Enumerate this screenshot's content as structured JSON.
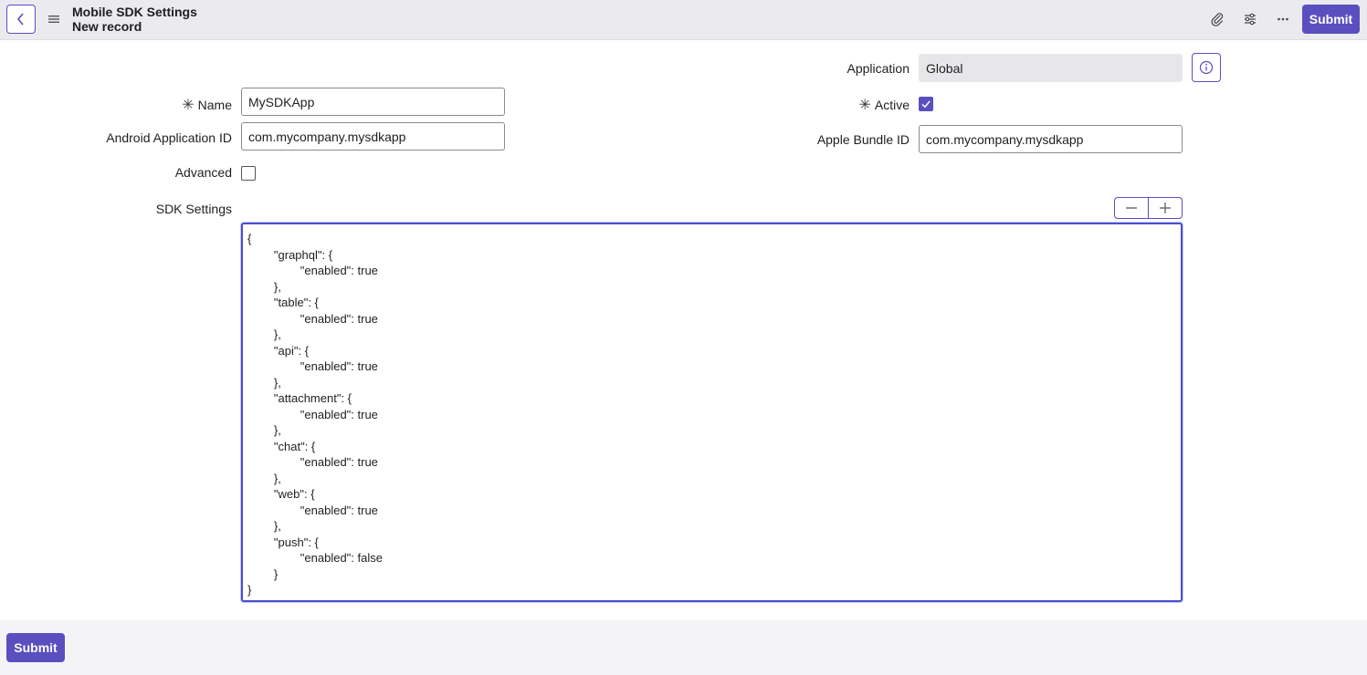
{
  "header": {
    "title": "Mobile SDK Settings",
    "subtitle": "New record",
    "submit_label": "Submit",
    "icons": [
      "back-icon",
      "menu-icon",
      "paperclip-icon",
      "sliders-icon",
      "more-icon"
    ]
  },
  "form": {
    "application": {
      "label": "Application",
      "value": "Global"
    },
    "name": {
      "label": "Name",
      "required_mark": "✳",
      "value": "MySDKApp"
    },
    "active": {
      "label": "Active",
      "required_mark": "✳",
      "checked": true
    },
    "android_app_id": {
      "label": "Android Application ID",
      "value": "com.mycompany.mysdkapp"
    },
    "apple_bundle_id": {
      "label": "Apple Bundle ID",
      "value": "com.mycompany.mysdkapp"
    },
    "advanced": {
      "label": "Advanced",
      "checked": false
    },
    "sdk_settings": {
      "label": "SDK Settings",
      "value": "{\n        \"graphql\": {\n                \"enabled\": true\n        },\n        \"table\": {\n                \"enabled\": true\n        },\n        \"api\": {\n                \"enabled\": true\n        },\n        \"attachment\": {\n                \"enabled\": true\n        },\n        \"chat\": {\n                \"enabled\": true\n        },\n        \"web\": {\n                \"enabled\": true\n        },\n        \"push\": {\n                \"enabled\": false\n        }\n}"
    }
  },
  "footer": {
    "submit_label": "Submit"
  },
  "colors": {
    "accent": "#5a4fbf",
    "header_bg": "#ebebef",
    "readonly_bg": "#e7e7ea",
    "focus_border": "#4a4fd1"
  }
}
